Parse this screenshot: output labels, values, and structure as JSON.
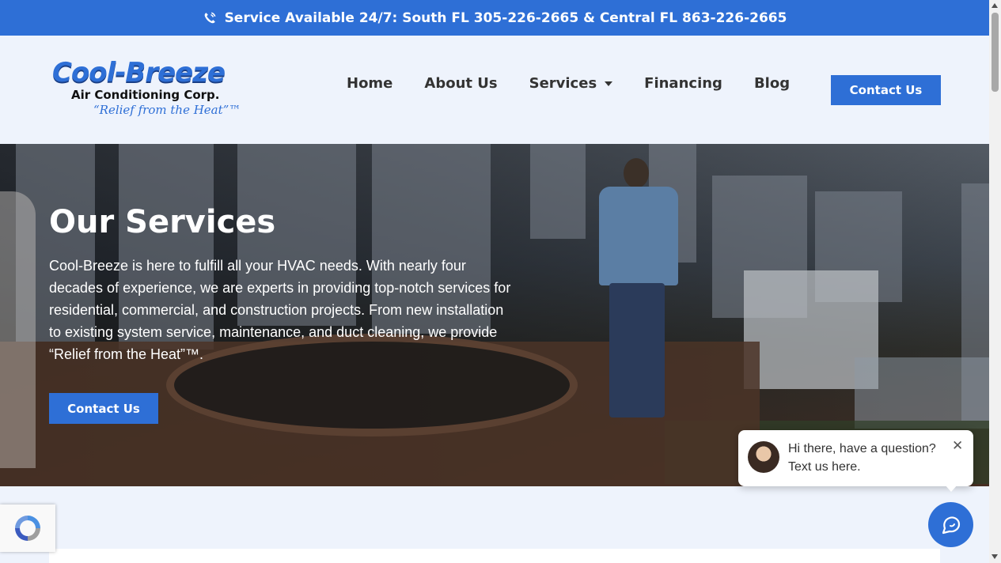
{
  "topbar": {
    "text": "Service Available 24/7: South FL 305-226-2665 & Central FL 863-226-2665",
    "icon": "phone-ringing-icon"
  },
  "logo": {
    "main": "Cool-Breeze",
    "sub": "Air Conditioning Corp.",
    "tagline": "“Relief from the Heat”™"
  },
  "nav": {
    "items": [
      {
        "label": "Home"
      },
      {
        "label": "About Us"
      },
      {
        "label": "Services",
        "has_dropdown": true
      },
      {
        "label": "Financing"
      },
      {
        "label": "Blog"
      }
    ],
    "contact_label": "Contact Us"
  },
  "hero": {
    "title": "Our Services",
    "text": "Cool-Breeze is here to fulfill all your HVAC needs. With nearly four decades of experience, we are experts in providing top-notch services for residential, commercial, and construction projects. From new installation to existing system service, maintenance, and duct cleaning, we provide “Relief from the Heat”™.",
    "button_label": "Contact Us"
  },
  "chat": {
    "message": "Hi there, have a question? Text us here.",
    "close_icon": "close-icon",
    "launcher_icon": "chat-bubble-icon"
  },
  "colors": {
    "accent": "#2e6fd6",
    "page_bg": "#eef3fc"
  }
}
